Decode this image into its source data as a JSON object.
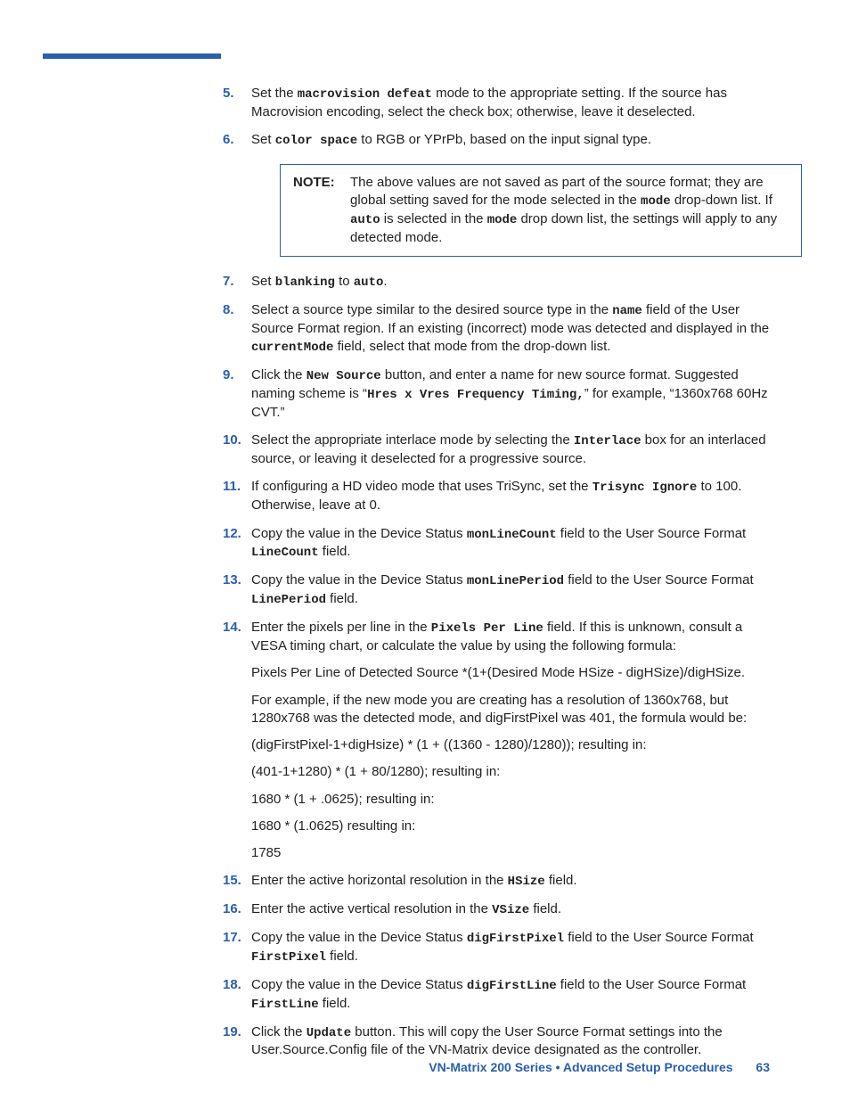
{
  "steps": {
    "s5": {
      "num": "5.",
      "pre": "Set the ",
      "code1": "macrovision defeat",
      "post": " mode to the appropriate setting. If the source has Macrovision encoding, select the check box; otherwise, leave it deselected."
    },
    "s6": {
      "num": "6.",
      "pre": "Set ",
      "code1": "color space",
      "post": " to RGB or YPrPb, based on the input signal type."
    },
    "note": {
      "label": "NOTE:",
      "t1": "The above values are not saved as part of the source format; they are global setting saved for the mode selected in the ",
      "c1": "mode",
      "t2": " drop-down list. If ",
      "c2": "auto",
      "t3": " is selected in the ",
      "c3": "mode",
      "t4": " drop down list, the settings will apply to any detected mode."
    },
    "s7": {
      "num": "7.",
      "pre": "Set ",
      "code1": "blanking",
      "mid": " to ",
      "code2": "auto",
      "post": "."
    },
    "s8": {
      "num": "8.",
      "t1": "Select a source type similar to the desired source type in the ",
      "c1": "name",
      "t2": " field of the User Source Format region. If an existing (incorrect) mode was detected and displayed in the ",
      "c2": "currentMode",
      "t3": " field, select that mode from the drop-down list."
    },
    "s9": {
      "num": "9.",
      "t1": "Click the ",
      "c1": "New Source",
      "t2": " button, and enter a name for new source format. Suggested naming scheme is “",
      "c2": "Hres x Vres Frequency Timing,",
      "t3": "” for example, “1360x768 60Hz CVT.”"
    },
    "s10": {
      "num": "10.",
      "t1": "Select the appropriate interlace mode by selecting the ",
      "c1": "Interlace",
      "t2": " box for an interlaced source, or leaving it deselected for a progressive source."
    },
    "s11": {
      "num": "11.",
      "t1": "If configuring a HD video mode that uses TriSync, set the ",
      "c1": "Trisync Ignore",
      "t2": " to 100. Otherwise, leave at 0."
    },
    "s12": {
      "num": "12.",
      "t1": "Copy the value in the Device Status ",
      "c1": "monLineCount",
      "t2": " field to the User Source Format ",
      "c2": "LineCount",
      "t3": " field."
    },
    "s13": {
      "num": "13.",
      "t1": "Copy the value in the Device Status ",
      "c1": "monLinePeriod",
      "t2": " field to the User Source Format ",
      "c2": "LinePeriod",
      "t3": " field."
    },
    "s14": {
      "num": "14.",
      "t1": "Enter the pixels per line in the ",
      "c1": "Pixels Per Line",
      "t2": " field. If this is unknown, consult a VESA timing chart, or calculate the value by using the following formula:",
      "p1": "Pixels Per Line of Detected Source *(1+(Desired Mode HSize - digHSize)/digHSize.",
      "p2": "For example, if the new mode you are creating has a resolution of 1360x768, but 1280x768 was the detected mode, and digFirstPixel was 401, the formula would be:",
      "p3": "(digFirstPixel-1+digHsize) * (1 + ((1360 - 1280)/1280)); resulting in:",
      "p4": "(401-1+1280) * (1 + 80/1280); resulting in:",
      "p5": "1680 * (1 + .0625); resulting in:",
      "p6": "1680 * (1.0625) resulting in:",
      "p7": "1785"
    },
    "s15": {
      "num": "15.",
      "t1": "Enter the active horizontal resolution in the ",
      "c1": "HSize",
      "t2": " field."
    },
    "s16": {
      "num": "16.",
      "t1": "Enter the active vertical resolution in the ",
      "c1": "VSize",
      "t2": " field."
    },
    "s17": {
      "num": "17.",
      "t1": "Copy the value in the Device Status ",
      "c1": "digFirstPixel",
      "t2": " field to the User Source Format ",
      "c2": "FirstPixel",
      "t3": " field."
    },
    "s18": {
      "num": "18.",
      "t1": "Copy the value in the Device Status ",
      "c1": "digFirstLine",
      "t2": " field to the User Source Format ",
      "c2": "FirstLine",
      "t3": " field."
    },
    "s19": {
      "num": "19.",
      "t1": "Click the ",
      "c1": "Update",
      "t2": " button. This will copy the User Source Format settings into the User.Source.Config file of the VN-Matrix device designated as the controller."
    }
  },
  "footer": {
    "title": "VN-Matrix 200 Series  •  Advanced Setup Procedures",
    "page": "63"
  }
}
